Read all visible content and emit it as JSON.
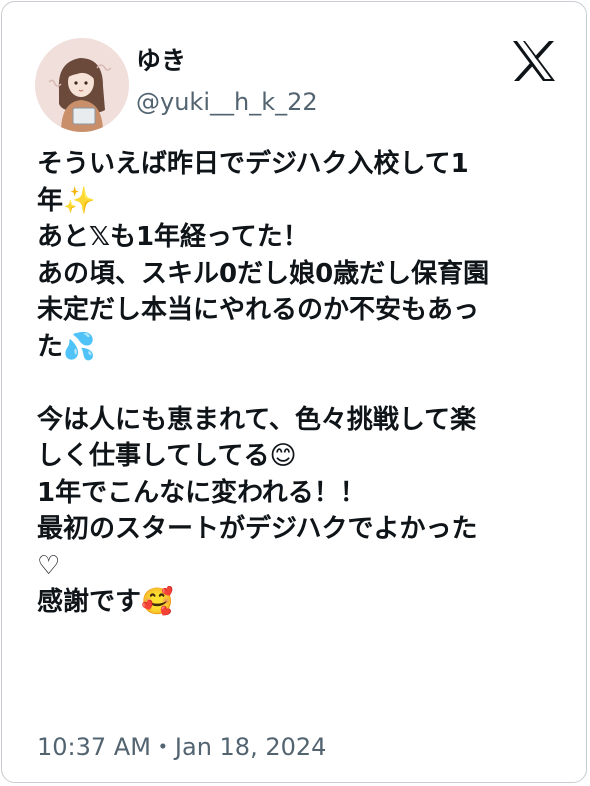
{
  "author": {
    "display_name": "ゆき",
    "handle": "@yuki__h_k_22"
  },
  "brand": {
    "logo_icon": "x-logo-icon",
    "avatar_icon": "profile-illustration-avatar"
  },
  "tweet": {
    "lines": [
      "そういえば昨日でデジハク入校して1",
      "年✨",
      "あと𝕏も1年経ってた！",
      "あの頃、スキル0だし娘0歳だし保育園",
      "未定だし本当にやれるのか不安もあっ",
      "た💦",
      "",
      "今は人にも恵まれて、色々挑戦して楽",
      "しく仕事してしてる😊",
      "1年でこんなに変われる！！",
      "最初のスタートがデジハクでよかった",
      "♡",
      "感謝です🥰"
    ]
  },
  "meta": {
    "timestamp": "10:37 AM・Jan 18, 2024"
  },
  "colors": {
    "text": "#0f1419",
    "secondary_text": "#536471",
    "border": "#c9cdd1"
  }
}
